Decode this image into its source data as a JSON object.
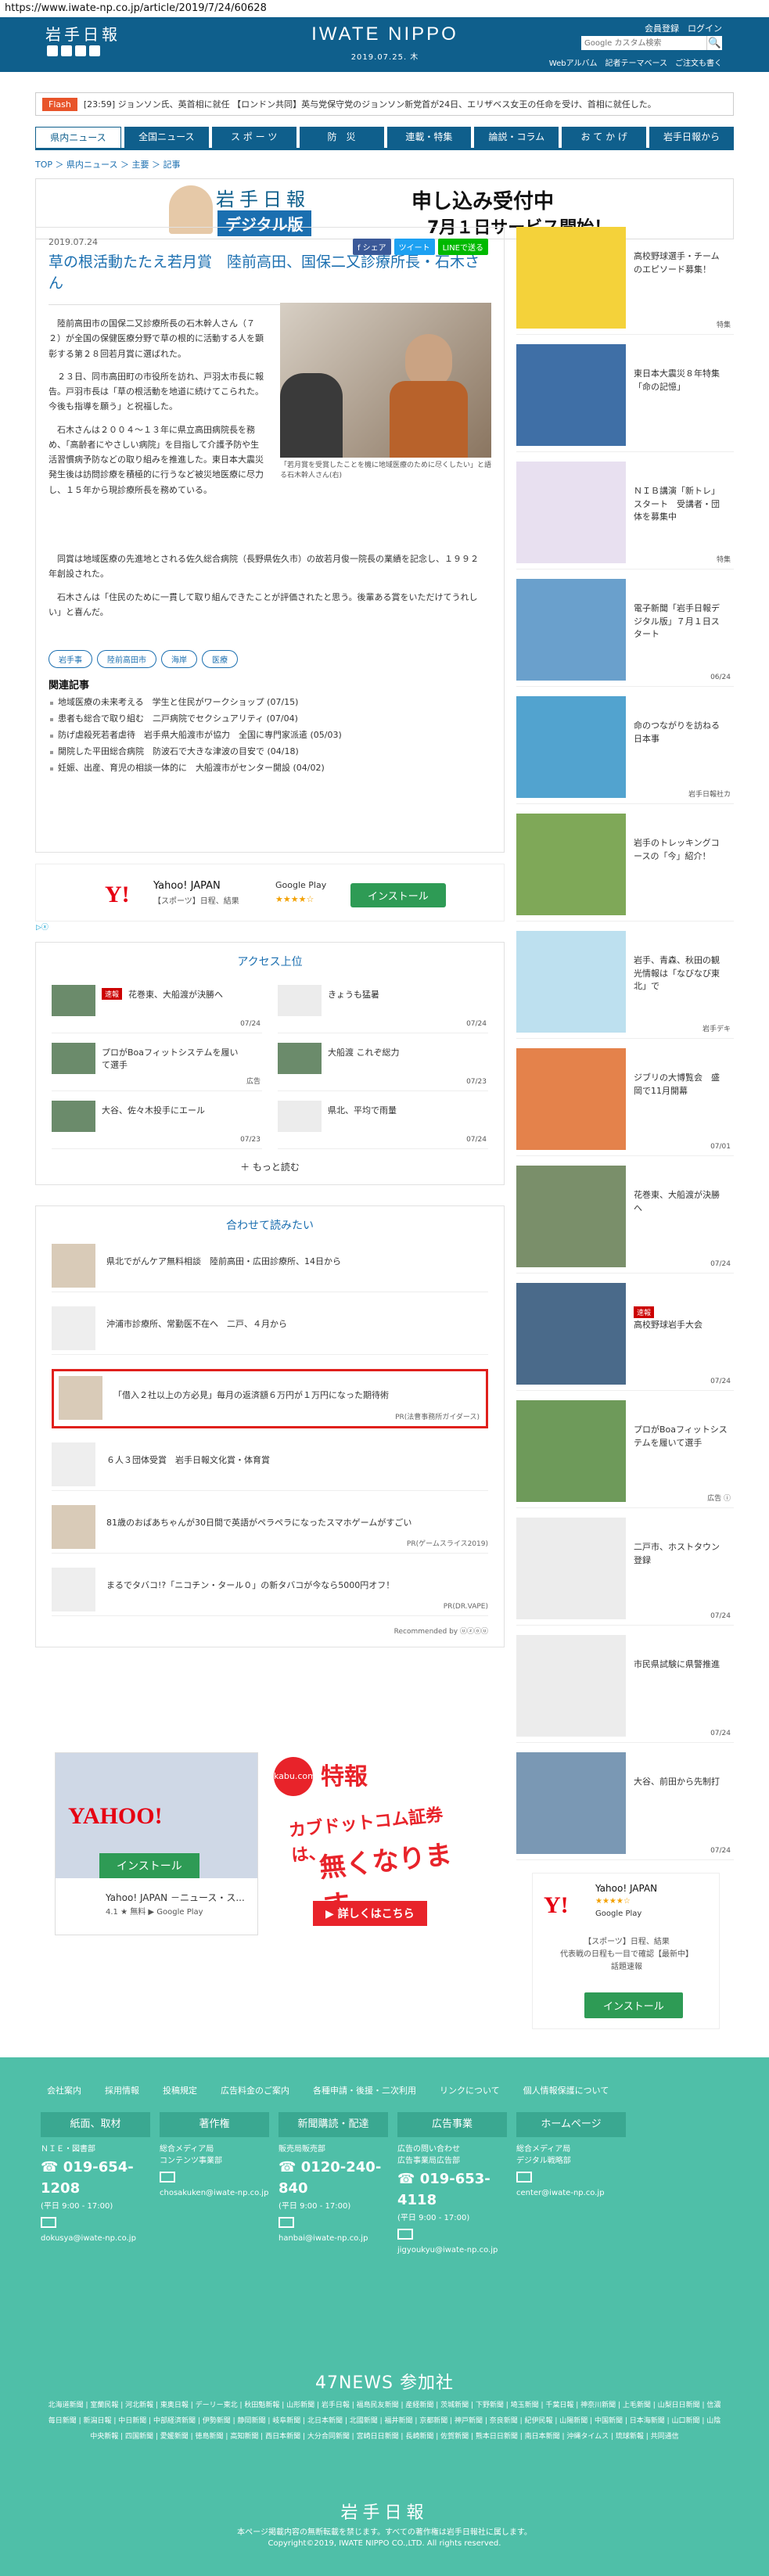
{
  "url": "https://www.iwate-np.co.jp/article/2019/7/24/60628",
  "header": {
    "logo": "岩手日報",
    "brand": "IWATE NIPPO",
    "date": "2019.07.25. 木",
    "member": "会員登録　ログイン",
    "search_placeholder": "Google カスタム検索",
    "sublinks": [
      "Webアルバム",
      "記者テーマベース",
      "ご注文も書く"
    ]
  },
  "flash": {
    "tag": "Flash",
    "text": "[23:59] ジョンソン氏、英首相に就任 【ロンドン共同】英与党保守党のジョンソン新党首が24日、エリザベス女王の任命を受け、首相に就任した。"
  },
  "nav": [
    "県内ニュース",
    "全国ニュース",
    "ス ポ ー ツ",
    "防　災",
    "連載・特集",
    "論説・コラム",
    "お て か げ",
    "岩手日報から"
  ],
  "breadcrumb": "TOP ＞ 県内ニュース ＞ 主要 ＞ 記事",
  "banner": {
    "logo": "岩手日報",
    "digital": "デジタル版",
    "main": "申し込み受付中",
    "sub": "7月１日サービス開始！"
  },
  "article": {
    "date": "2019.07.24",
    "share": [
      "f シェア",
      "ツイート",
      "LINEで送る"
    ],
    "title": "草の根活動たたえ若月賞　陸前高田、国保二又診療所長・石木さん",
    "caption": "「若月賞を受賞したことを機に地域医療のために尽くしたい」と語る石木幹人さん(右)",
    "paras_short": [
      "陸前高田市の国保二又診療所長の石木幹人さん（７２）が全国の保健医療分野で草の根的に活動する人を顕彰する第２８回若月賞に選ばれた。",
      "２３日、同市高田町の市役所を訪れ、戸羽太市長に報告。戸羽市長は「草の根活動を地道に続けてこられた。今後も指導を願う」と祝福した。",
      "石木さんは２００４～１３年に県立高田病院長を務め、「高齢者にやさしい病院」を目指して介護予防や生活習慣病予防などの取り組みを推進した。東日本大震災発生後は訪問診療を積極的に行うなど被災地医療に尽力し、１５年から現診療所長を務めている。"
    ],
    "paras_full": [
      "同賞は地域医療の先進地とされる佐久総合病院（長野県佐久市）の故若月俊一院長の業績を記念し、１９９２年創設された。",
      "石木さんは「住民のために一貫して取り組んできたことが評価されたと思う。後輩ある賞をいただけてうれしい」と喜んだ。"
    ],
    "tags": [
      "岩手事",
      "陸前高田市",
      "海岸",
      "医療"
    ],
    "related_title": "関連記事",
    "related": [
      "地域医療の未来考える　学生と住民がワークショップ (07/15)",
      "患者も総合で取り組む　二戸病院でセクシュアリティ (07/04)",
      "防げ虐殺死若者虐待　岩手県大船渡市が協力　全国に専門家派遣 (05/03)",
      "開院した平田総合病院　防波石で大きな津波の目安で (04/18)",
      "妊娠、出産、育児の相談一体的に　大船渡市がセンター開設 (04/02)"
    ]
  },
  "app_ad": {
    "name": "Yahoo! JAPAN",
    "sub": "【スポーツ】日程、結果",
    "store": "Google Play",
    "stars": "★★★★☆",
    "button": "インストール",
    "adx": "▷ⓧ"
  },
  "ranking": {
    "title": "アクセス上位",
    "items": [
      {
        "badge": "速報",
        "label": "花巻東、大船渡が決勝へ",
        "date": "07/24",
        "gray": false
      },
      {
        "badge": "",
        "label": "きょうも猛暑",
        "date": "07/24",
        "gray": true
      },
      {
        "badge": "",
        "label": "プロがBoaフィットシステムを履いて選手",
        "date": "広告",
        "gray": false
      },
      {
        "badge": "",
        "label": "大船渡 これぞ総力",
        "date": "07/23",
        "gray": false
      },
      {
        "badge": "",
        "label": "大谷、佐々木投手にエール",
        "date": "07/23",
        "gray": false
      },
      {
        "badge": "",
        "label": "県北、平均で雨量",
        "date": "07/24",
        "gray": true
      }
    ],
    "more": "＋ もっと読む"
  },
  "recommend": {
    "title": "合わせて読みたい",
    "items": [
      {
        "label": "県北でがんケア無料相談　陸前高田・広田診療所、14日から",
        "pr": "",
        "hl": false,
        "gray": false
      },
      {
        "label": "沖浦市診療所、常勤医不在へ　二戸、４月から",
        "pr": "",
        "hl": false,
        "gray": true
      },
      {
        "label": "「借入２社以上の方必見」毎月の返済額６万円が１万円になった期待術",
        "pr": "PR(法曹事務所ガイダース)",
        "hl": true,
        "gray": false
      },
      {
        "label": "６人３団体受賞　岩手日報文化賞・体育賞",
        "pr": "",
        "hl": false,
        "gray": true
      },
      {
        "label": "81歳のおばあちゃんが30日間で英語がペラペラになったスマホゲームがすごい",
        "pr": "PR(ゲームスライス2019)",
        "hl": false,
        "gray": false
      },
      {
        "label": "まるでタバコ!?「ニコチン・タール０」の新タバコが今なら5000円オフ！",
        "pr": "PR(DR.VAPE)",
        "hl": false,
        "gray": true
      }
    ],
    "powered": "Recommended by  ⓤⓩⓞⓤ"
  },
  "bottom_ads": {
    "yahoo_brand": "YAHOO!",
    "yahoo_button": "インストール",
    "yahoo_title": "Yahoo! JAPAN －ニュース・ス...",
    "yahoo_meta": "4.1 ★ 無料  ▶ Google Play",
    "kabu_circle": "kabu.com",
    "kabu_tokuho": "特報",
    "kabu_m1": "カブドットコム証券は、",
    "kabu_m2": "無くなります。",
    "kabu_m3": "▶ 詳しくはこちら"
  },
  "sidebar": {
    "items": [
      {
        "badge": "",
        "label": "高校野球選手・チームのエピソード募集！",
        "date": "特集",
        "gray": false
      },
      {
        "badge": "",
        "label": "東日本大震災８年特集「命の記憶」",
        "date": "",
        "gray": false
      },
      {
        "badge": "",
        "label": "ＮＩＢ講演「新トレ」スタート　受講者・団体を募集中",
        "date": "特集",
        "gray": false
      },
      {
        "badge": "",
        "label": "電子新聞「岩手日報デジタル版」７月１日スタート",
        "date": "06/24",
        "gray": false
      },
      {
        "badge": "",
        "label": "命のつながりを訪ねる日本事",
        "date": "岩手日報社カ",
        "gray": false
      },
      {
        "badge": "",
        "label": "岩手のトレッキングコースの「今」紹介！",
        "date": "",
        "gray": false
      },
      {
        "badge": "",
        "label": "岩手、青森、秋田の観光情報は「なびなび東北」で",
        "date": "岩手デキ",
        "gray": false
      },
      {
        "badge": "",
        "label": "ジブリの大博覧会　盛岡で11月開幕",
        "date": "07/01",
        "gray": false
      },
      {
        "badge": "",
        "label": "花巻東、大船渡が決勝へ",
        "date": "07/24",
        "gray": false
      },
      {
        "badge": "速報",
        "label": "高校野球岩手大会",
        "date": "07/24",
        "gray": false
      },
      {
        "badge": "",
        "label": "プロがBoaフィットシステムを履いて選手",
        "date": "広告 ⓘ",
        "gray": false
      },
      {
        "badge": "",
        "label": "二戸市、ホストタウン登録",
        "date": "07/24",
        "gray": true
      },
      {
        "badge": "",
        "label": "市民県試験に県警推進",
        "date": "07/24",
        "gray": true
      },
      {
        "badge": "",
        "label": "大谷、前田から先制打",
        "date": "07/24",
        "gray": false
      }
    ],
    "ad_title": "Yahoo! JAPAN",
    "ad_stars": "★★★★☆",
    "ad_store": "Google Play",
    "ad_sub": "【スポーツ】日程、結果\n代表戦の日程も一目で確認【最新中】\n話題速報",
    "ad_button": "インストール"
  },
  "footer": {
    "links": [
      "会社案内",
      "採用情報",
      "投稿規定",
      "広告料金のご案内",
      "各種申請・後援・二次利用",
      "リンクについて",
      "個人情報保護について"
    ],
    "cols": [
      {
        "head": "紙面、取材",
        "lines": [
          "ＮＩＥ・図書部"
        ],
        "tel": "019-654-1208",
        "hours": "(平日 9:00 - 17:00)",
        "mail": "dokusya@iwate-np.co.jp"
      },
      {
        "head": "著作権",
        "lines": [
          "総合メディア局",
          "コンテンツ事業部"
        ],
        "tel": "",
        "hours": "",
        "mail": "chosakuken@iwate-np.co.jp"
      },
      {
        "head": "新聞購読・配達",
        "lines": [
          "販売局販売部"
        ],
        "tel": "0120-240-840",
        "hours": "(平日 9:00 - 17:00)",
        "mail": "hanbai@iwate-np.co.jp"
      },
      {
        "head": "広告事業",
        "lines": [
          "広告の問い合わせ",
          "広告事業局広告部"
        ],
        "tel": "019-653-4118",
        "hours": "(平日 9:00 - 17:00)",
        "mail": "jigyoukyu@iwate-np.co.jp"
      },
      {
        "head": "ホームページ",
        "lines": [
          "総合メディア局",
          "デジタル戦略部"
        ],
        "tel": "",
        "hours": "",
        "mail": "center@iwate-np.co.jp"
      }
    ],
    "news47": "47NEWS 参加社",
    "names": "北海道新聞 | 室蘭民報 | 河北新報 | 東奥日報 | デーリー東北 | 秋田魁新報 | 山形新聞 | 岩手日報 | 福島民友新聞 | 産経新聞 | 茨城新聞 | 下野新聞 | 埼玉新聞 | 千葉日報 | 神奈川新聞 | 上毛新聞 | 山梨日日新聞 | 信濃毎日新聞 | 新潟日報 | 中日新聞 | 中部経済新聞 | 伊勢新聞 | 静岡新聞 | 岐阜新聞 | 北日本新聞 | 北國新聞 | 福井新聞 | 京都新聞 | 神戸新聞 | 奈良新聞 | 紀伊民報 | 山陽新聞 | 中国新聞 | 日本海新聞 | 山口新聞 | 山陰中央新報 | 四国新聞 | 愛媛新聞 | 徳島新聞 | 高知新聞 | 西日本新聞 | 大分合同新聞 | 宮崎日日新聞 | 長崎新聞 | 佐賀新聞 | 熊本日日新聞 | 南日本新聞 | 沖縄タイムス | 琉球新報 | 共同通信",
    "logo": "岩手日報",
    "note": "本ページ掲載内容の無断転載を禁じます。すべての著作権は岩手日報社に属します。",
    "copy": "Copyright©2019, IWATE NIPPO CO.,LTD. All rights reserved."
  }
}
